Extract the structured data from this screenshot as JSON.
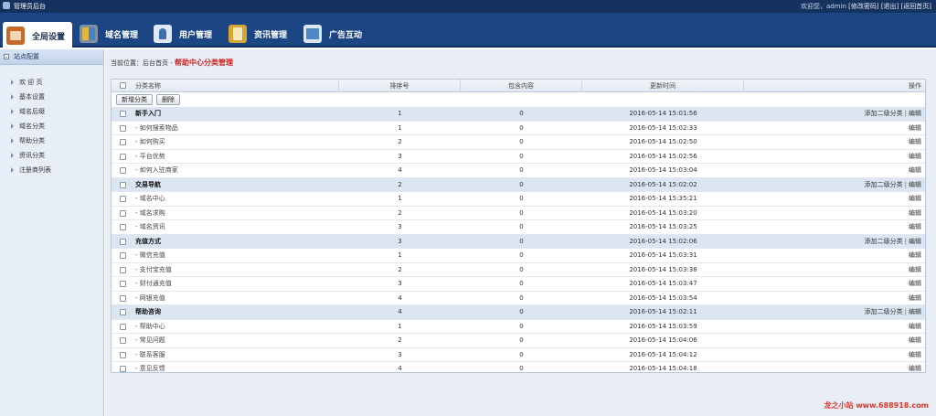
{
  "header": {
    "app_title": "管理员后台",
    "welcome_text": "欢迎您，admin",
    "change_password": "[修改密码]",
    "logout": "[退出]",
    "back_home": "[返回首页]"
  },
  "nav": [
    {
      "label": "全局设置",
      "icon": "settings-icon",
      "active": true
    },
    {
      "label": "域名管理",
      "icon": "domain-icon"
    },
    {
      "label": "用户管理",
      "icon": "user-icon"
    },
    {
      "label": "资讯管理",
      "icon": "news-icon"
    },
    {
      "label": "广告互动",
      "icon": "ad-icon"
    }
  ],
  "sidebar": {
    "heading": "站点配置",
    "items": [
      "欢 迎 页",
      "基本设置",
      "域名后缀",
      "域名分类",
      "帮助分类",
      "资讯分类",
      "注册商列表"
    ]
  },
  "breadcrumb": {
    "prefix": "当前位置：",
    "home": "后台首页",
    "sep": " - ",
    "current": "帮助中心分类管理"
  },
  "table": {
    "columns": {
      "name": "分类名称",
      "sort": "排序号",
      "count": "包含内容",
      "updated": "更新时间",
      "actions": "操作"
    },
    "toolbar": {
      "add_label": "新增分类",
      "delete_label": "删除"
    },
    "action_labels": {
      "add_sub": "添加二级分类",
      "divider": "|",
      "edit": "编辑"
    },
    "rows": [
      {
        "type": "parent",
        "name": "新手入门",
        "sort": "1",
        "count": "0",
        "updated": "2016-05-14 15:01:56"
      },
      {
        "type": "child",
        "name": "- 如何搜索物品",
        "sort": "1",
        "count": "0",
        "updated": "2016-05-14 15:02:33"
      },
      {
        "type": "child",
        "name": "- 如何购买",
        "sort": "2",
        "count": "0",
        "updated": "2016-05-14 15:02:50"
      },
      {
        "type": "child",
        "name": "- 平台优势",
        "sort": "3",
        "count": "0",
        "updated": "2016-05-14 15:02:56"
      },
      {
        "type": "child",
        "name": "- 如何入驻商家",
        "sort": "4",
        "count": "0",
        "updated": "2016-05-14 15:03:04"
      },
      {
        "type": "parent",
        "name": "交易导航",
        "sort": "2",
        "count": "0",
        "updated": "2016-05-14 15:02:02"
      },
      {
        "type": "child",
        "name": "- 域名中心",
        "sort": "1",
        "count": "0",
        "updated": "2016-05-14 15:35:21"
      },
      {
        "type": "child",
        "name": "- 域名求购",
        "sort": "2",
        "count": "0",
        "updated": "2016-05-14 15:03:20"
      },
      {
        "type": "child",
        "name": "- 域名资讯",
        "sort": "3",
        "count": "0",
        "updated": "2016-05-14 15:03:25"
      },
      {
        "type": "parent",
        "name": "充值方式",
        "sort": "3",
        "count": "0",
        "updated": "2016-05-14 15:02:06"
      },
      {
        "type": "child",
        "name": "- 微信充值",
        "sort": "1",
        "count": "0",
        "updated": "2016-05-14 15:03:31"
      },
      {
        "type": "child",
        "name": "- 支付宝充值",
        "sort": "2",
        "count": "0",
        "updated": "2016-05-14 15:03:38"
      },
      {
        "type": "child",
        "name": "- 财付通充值",
        "sort": "3",
        "count": "0",
        "updated": "2016-05-14 15:03:47"
      },
      {
        "type": "child",
        "name": "- 网银充值",
        "sort": "4",
        "count": "0",
        "updated": "2016-05-14 15:03:54"
      },
      {
        "type": "parent",
        "name": "帮助咨询",
        "sort": "4",
        "count": "0",
        "updated": "2016-05-14 15:02:11"
      },
      {
        "type": "child",
        "name": "- 帮助中心",
        "sort": "1",
        "count": "0",
        "updated": "2016-05-14 15:03:59"
      },
      {
        "type": "child",
        "name": "- 常见问题",
        "sort": "2",
        "count": "0",
        "updated": "2016-05-14 15:04:06"
      },
      {
        "type": "child",
        "name": "- 联系客服",
        "sort": "3",
        "count": "0",
        "updated": "2016-05-14 15:04:12"
      },
      {
        "type": "child",
        "name": "- 意见反馈",
        "sort": "4",
        "count": "0",
        "updated": "2016-05-14 15:04:18"
      }
    ]
  },
  "watermark": "龙之小站  www.688918.com",
  "colors": {
    "top_bar": "#15325e",
    "nav_bar": "#1b4583",
    "parent_row": "#dce6f2",
    "breadcrumb_current": "#cc2222"
  }
}
